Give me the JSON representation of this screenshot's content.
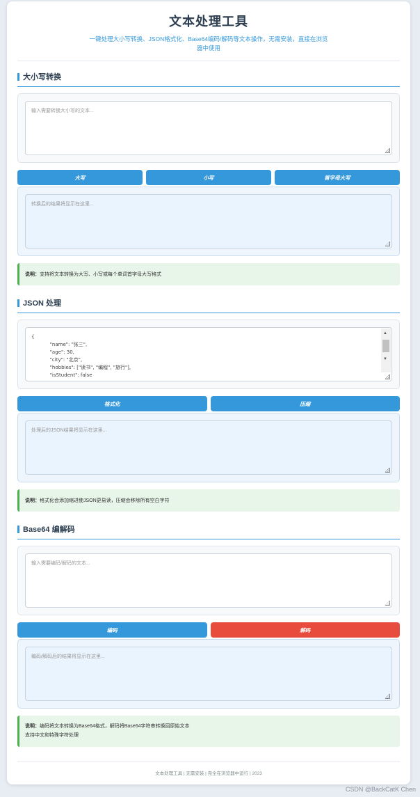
{
  "header": {
    "title": "文本处理工具",
    "subtitle": "一键处理大小写转换、JSON格式化、Base64编码/解码等文本操作，无需安装，直接在浏览器中使用"
  },
  "case_section": {
    "title": "大小写转换",
    "input_placeholder": "输入需要转换大小写的文本...",
    "buttons": {
      "upper": "大写",
      "lower": "小写",
      "capitalize": "首字母大写"
    },
    "result_placeholder": "转换后的结果将显示在这里...",
    "note_label": "说明：",
    "note_text": "支持将文本转换为大写、小写或每个单词首字母大写格式"
  },
  "json_section": {
    "title": "JSON 处理",
    "input_value": "{\n            \"name\": \"张三\",\n            \"age\": 30,\n            \"city\": \"北京\",\n            \"hobbies\": [\"读书\", \"编程\", \"旅行\"],\n            \"isStudent\": false",
    "buttons": {
      "format": "格式化",
      "compress": "压缩"
    },
    "result_placeholder": "处理后的JSON结果将显示在这里...",
    "note_label": "说明：",
    "note_text": "格式化会添加缩进使JSON更易读，压缩会移除所有空白字符"
  },
  "base64_section": {
    "title": "Base64 编解码",
    "input_placeholder": "输入需要编码/解码的文本...",
    "buttons": {
      "encode": "编码",
      "decode": "解码"
    },
    "result_placeholder": "编码/解码后的结果将显示在这里...",
    "note_label": "说明：",
    "note_text_1": "编码将文本转换为Base64格式，解码将Base64字符串转换回原始文本",
    "note_text_2": "支持中文和特殊字符处理"
  },
  "footer": {
    "text": "文本处理工具 | 无需安装 | 完全在浏览器中运行 | 2023"
  },
  "watermark": "CSDN @BackCatK Chen",
  "colors": {
    "primary": "#3498db",
    "danger": "#e74c3c",
    "note_border": "#4caf50",
    "note_bg": "#e8f5e9"
  }
}
